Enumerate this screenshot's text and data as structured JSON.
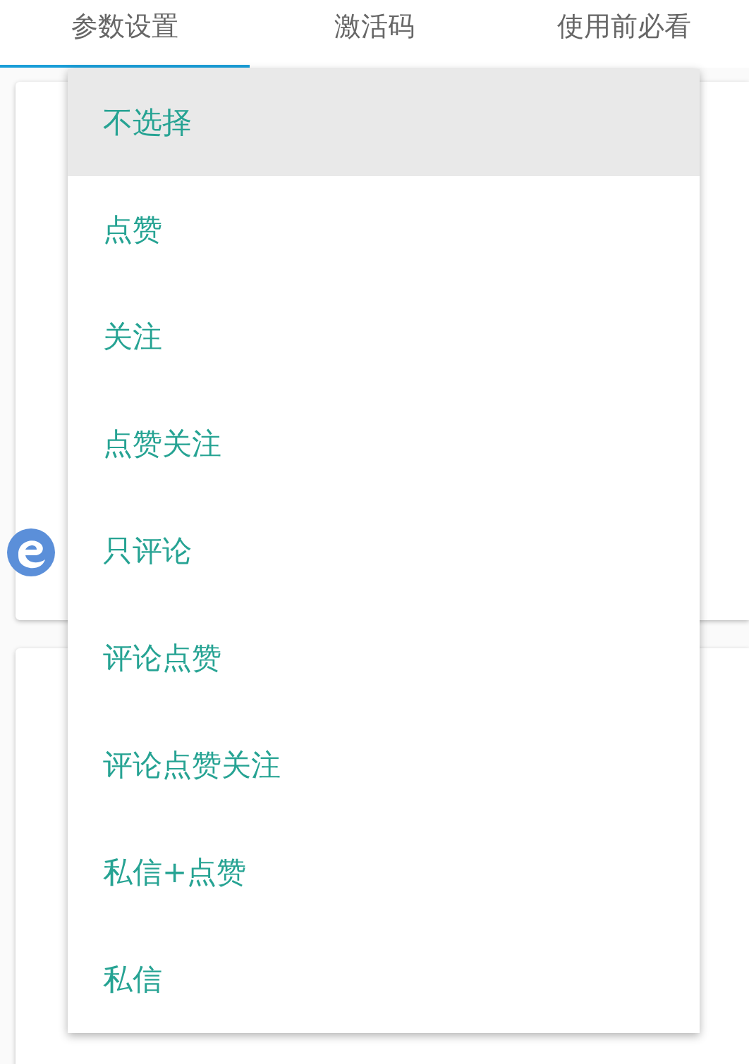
{
  "tabs": [
    {
      "label": "参数设置",
      "selected": true
    },
    {
      "label": "激活码",
      "selected": false
    },
    {
      "label": "使用前必看",
      "selected": false
    }
  ],
  "dropdown": {
    "options": [
      {
        "label": "不选择",
        "selected": true
      },
      {
        "label": "点赞",
        "selected": false
      },
      {
        "label": "关注",
        "selected": false
      },
      {
        "label": "点赞关注",
        "selected": false
      },
      {
        "label": "只评论",
        "selected": false
      },
      {
        "label": "评论点赞",
        "selected": false
      },
      {
        "label": "评论点赞关注",
        "selected": false
      },
      {
        "label": "私信+点赞",
        "selected": false
      },
      {
        "label": "私信",
        "selected": false
      }
    ]
  }
}
